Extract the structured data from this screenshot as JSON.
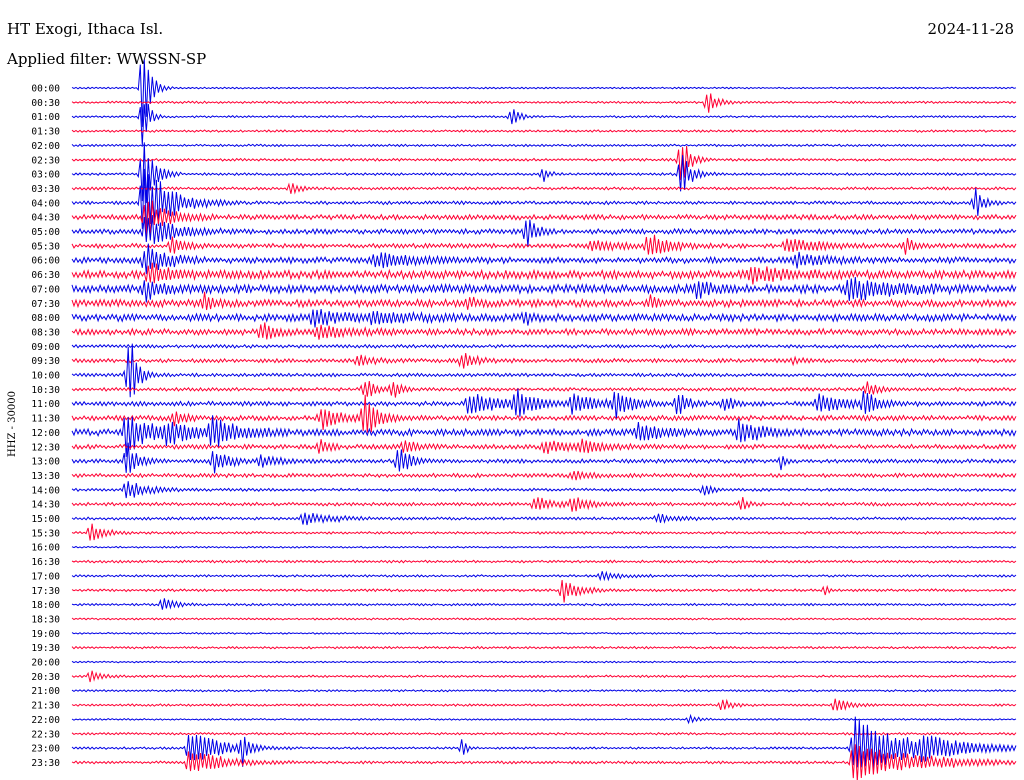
{
  "header": {
    "station": "HT Exogi, Ithaca Isl.",
    "date": "2024-11-28",
    "filter_text": "Applied filter: WWSSN-SP"
  },
  "chart_data": {
    "type": "line",
    "title": "HT Exogi, Ithaca Isl.",
    "channel_label": "HHZ - 30000",
    "colors": [
      "#0000e6",
      "#ff0033"
    ],
    "rows": [
      "00:00",
      "00:30",
      "01:00",
      "01:30",
      "02:00",
      "02:30",
      "03:00",
      "03:30",
      "04:00",
      "04:30",
      "05:00",
      "05:30",
      "06:00",
      "06:30",
      "07:00",
      "07:30",
      "08:00",
      "08:30",
      "09:00",
      "09:30",
      "10:00",
      "10:30",
      "11:00",
      "11:30",
      "12:00",
      "12:30",
      "13:00",
      "13:30",
      "14:00",
      "14:30",
      "15:00",
      "15:30",
      "16:00",
      "16:30",
      "17:00",
      "17:30",
      "18:00",
      "18:30",
      "19:00",
      "19:30",
      "20:00",
      "20:30",
      "21:00",
      "21:30",
      "22:00",
      "22:30",
      "23:00",
      "23:30"
    ],
    "noise": [
      0.6,
      0.8,
      0.7,
      0.8,
      0.8,
      0.9,
      0.9,
      1.0,
      1.2,
      1.8,
      1.8,
      1.6,
      2.2,
      3.0,
      3.0,
      2.6,
      2.6,
      2.2,
      1.2,
      1.4,
      1.2,
      1.2,
      1.6,
      1.8,
      2.4,
      1.6,
      1.4,
      1.4,
      1.0,
      1.2,
      1.0,
      0.9,
      0.6,
      0.9,
      0.8,
      0.9,
      0.8,
      0.7,
      0.6,
      0.8,
      0.6,
      0.8,
      0.7,
      0.8,
      0.6,
      0.8,
      0.8,
      1.0
    ],
    "events": [
      {
        "row": 0,
        "t": 0.075,
        "amp": 45,
        "w": 0.008
      },
      {
        "row": 1,
        "t": 0.673,
        "amp": 11,
        "w": 0.01
      },
      {
        "row": 2,
        "t": 0.075,
        "amp": 30,
        "w": 0.006
      },
      {
        "row": 2,
        "t": 0.466,
        "amp": 9,
        "w": 0.008
      },
      {
        "row": 5,
        "t": 0.645,
        "amp": 28,
        "w": 0.008
      },
      {
        "row": 6,
        "t": 0.075,
        "amp": 42,
        "w": 0.01
      },
      {
        "row": 6,
        "t": 0.499,
        "amp": 8,
        "w": 0.006
      },
      {
        "row": 6,
        "t": 0.645,
        "amp": 22,
        "w": 0.01
      },
      {
        "row": 7,
        "t": 0.232,
        "amp": 6,
        "w": 0.008
      },
      {
        "row": 8,
        "t": 0.075,
        "amp": 40,
        "w": 0.025
      },
      {
        "row": 8,
        "t": 0.957,
        "amp": 15,
        "w": 0.008
      },
      {
        "row": 9,
        "t": 0.078,
        "amp": 20,
        "w": 0.02
      },
      {
        "row": 10,
        "t": 0.078,
        "amp": 18,
        "w": 0.025
      },
      {
        "row": 10,
        "t": 0.482,
        "amp": 16,
        "w": 0.008
      },
      {
        "row": 11,
        "t": 0.105,
        "amp": 9,
        "w": 0.012
      },
      {
        "row": 11,
        "t": 0.55,
        "amp": 5,
        "w": 0.025
      },
      {
        "row": 11,
        "t": 0.61,
        "amp": 12,
        "w": 0.02
      },
      {
        "row": 11,
        "t": 0.757,
        "amp": 8,
        "w": 0.03
      },
      {
        "row": 11,
        "t": 0.883,
        "amp": 9,
        "w": 0.008
      },
      {
        "row": 12,
        "t": 0.078,
        "amp": 16,
        "w": 0.02
      },
      {
        "row": 12,
        "t": 0.32,
        "amp": 7,
        "w": 0.035
      },
      {
        "row": 12,
        "t": 0.766,
        "amp": 7,
        "w": 0.025
      },
      {
        "row": 13,
        "t": 0.082,
        "amp": 10,
        "w": 0.02
      },
      {
        "row": 13,
        "t": 0.718,
        "amp": 8,
        "w": 0.03
      },
      {
        "row": 14,
        "t": 0.078,
        "amp": 12,
        "w": 0.01
      },
      {
        "row": 14,
        "t": 0.662,
        "amp": 8,
        "w": 0.012
      },
      {
        "row": 14,
        "t": 0.822,
        "amp": 12,
        "w": 0.04
      },
      {
        "row": 15,
        "t": 0.14,
        "amp": 8,
        "w": 0.008
      },
      {
        "row": 15,
        "t": 0.42,
        "amp": 6,
        "w": 0.008
      },
      {
        "row": 15,
        "t": 0.612,
        "amp": 6,
        "w": 0.008
      },
      {
        "row": 16,
        "t": 0.254,
        "amp": 8,
        "w": 0.03
      },
      {
        "row": 16,
        "t": 0.318,
        "amp": 5,
        "w": 0.04
      },
      {
        "row": 16,
        "t": 0.48,
        "amp": 6,
        "w": 0.01
      },
      {
        "row": 17,
        "t": 0.2,
        "amp": 10,
        "w": 0.012
      },
      {
        "row": 17,
        "t": 0.26,
        "amp": 6,
        "w": 0.03
      },
      {
        "row": 19,
        "t": 0.303,
        "amp": 5,
        "w": 0.015
      },
      {
        "row": 19,
        "t": 0.413,
        "amp": 7,
        "w": 0.015
      },
      {
        "row": 19,
        "t": 0.765,
        "amp": 4,
        "w": 0.008
      },
      {
        "row": 20,
        "t": 0.06,
        "amp": 45,
        "w": 0.008
      },
      {
        "row": 21,
        "t": 0.31,
        "amp": 10,
        "w": 0.012
      },
      {
        "row": 21,
        "t": 0.34,
        "amp": 9,
        "w": 0.008
      },
      {
        "row": 21,
        "t": 0.842,
        "amp": 8,
        "w": 0.01
      },
      {
        "row": 22,
        "t": 0.42,
        "amp": 10,
        "w": 0.04
      },
      {
        "row": 22,
        "t": 0.47,
        "amp": 13,
        "w": 0.015
      },
      {
        "row": 22,
        "t": 0.53,
        "amp": 9,
        "w": 0.03
      },
      {
        "row": 22,
        "t": 0.576,
        "amp": 13,
        "w": 0.015
      },
      {
        "row": 22,
        "t": 0.641,
        "amp": 12,
        "w": 0.01
      },
      {
        "row": 22,
        "t": 0.69,
        "amp": 8,
        "w": 0.01
      },
      {
        "row": 22,
        "t": 0.79,
        "amp": 9,
        "w": 0.03
      },
      {
        "row": 22,
        "t": 0.84,
        "amp": 14,
        "w": 0.01
      },
      {
        "row": 23,
        "t": 0.108,
        "amp": 7,
        "w": 0.01
      },
      {
        "row": 23,
        "t": 0.264,
        "amp": 10,
        "w": 0.02
      },
      {
        "row": 23,
        "t": 0.309,
        "amp": 22,
        "w": 0.012
      },
      {
        "row": 24,
        "t": 0.058,
        "amp": 22,
        "w": 0.02
      },
      {
        "row": 24,
        "t": 0.1,
        "amp": 10,
        "w": 0.03
      },
      {
        "row": 24,
        "t": 0.148,
        "amp": 14,
        "w": 0.025
      },
      {
        "row": 24,
        "t": 0.6,
        "amp": 9,
        "w": 0.02
      },
      {
        "row": 24,
        "t": 0.707,
        "amp": 13,
        "w": 0.02
      },
      {
        "row": 25,
        "t": 0.262,
        "amp": 7,
        "w": 0.01
      },
      {
        "row": 25,
        "t": 0.352,
        "amp": 8,
        "w": 0.01
      },
      {
        "row": 25,
        "t": 0.5,
        "amp": 6,
        "w": 0.03
      },
      {
        "row": 25,
        "t": 0.54,
        "amp": 6,
        "w": 0.02
      },
      {
        "row": 26,
        "t": 0.058,
        "amp": 20,
        "w": 0.01
      },
      {
        "row": 26,
        "t": 0.15,
        "amp": 12,
        "w": 0.015
      },
      {
        "row": 26,
        "t": 0.2,
        "amp": 6,
        "w": 0.02
      },
      {
        "row": 26,
        "t": 0.346,
        "amp": 16,
        "w": 0.012
      },
      {
        "row": 26,
        "t": 0.752,
        "amp": 10,
        "w": 0.003
      },
      {
        "row": 27,
        "t": 0.53,
        "amp": 5,
        "w": 0.015
      },
      {
        "row": 28,
        "t": 0.058,
        "amp": 10,
        "w": 0.02
      },
      {
        "row": 28,
        "t": 0.67,
        "amp": 7,
        "w": 0.008
      },
      {
        "row": 29,
        "t": 0.49,
        "amp": 7,
        "w": 0.02
      },
      {
        "row": 29,
        "t": 0.53,
        "amp": 8,
        "w": 0.015
      },
      {
        "row": 29,
        "t": 0.71,
        "amp": 7,
        "w": 0.005
      },
      {
        "row": 30,
        "t": 0.245,
        "amp": 6,
        "w": 0.03
      },
      {
        "row": 30,
        "t": 0.62,
        "amp": 4,
        "w": 0.02
      },
      {
        "row": 31,
        "t": 0.02,
        "amp": 10,
        "w": 0.012
      },
      {
        "row": 34,
        "t": 0.56,
        "amp": 4,
        "w": 0.02
      },
      {
        "row": 35,
        "t": 0.52,
        "amp": 13,
        "w": 0.015
      },
      {
        "row": 35,
        "t": 0.798,
        "amp": 6,
        "w": 0.003
      },
      {
        "row": 36,
        "t": 0.096,
        "amp": 8,
        "w": 0.012
      },
      {
        "row": 41,
        "t": 0.02,
        "amp": 7,
        "w": 0.01
      },
      {
        "row": 43,
        "t": 0.688,
        "amp": 6,
        "w": 0.01
      },
      {
        "row": 43,
        "t": 0.808,
        "amp": 8,
        "w": 0.012
      },
      {
        "row": 44,
        "t": 0.655,
        "amp": 4,
        "w": 0.008
      },
      {
        "row": 46,
        "t": 0.124,
        "amp": 18,
        "w": 0.03
      },
      {
        "row": 46,
        "t": 0.181,
        "amp": 16,
        "w": 0.006
      },
      {
        "row": 46,
        "t": 0.414,
        "amp": 10,
        "w": 0.004
      },
      {
        "row": 46,
        "t": 0.828,
        "amp": 30,
        "w": 0.05
      },
      {
        "row": 46,
        "t": 0.9,
        "amp": 8,
        "w": 0.05
      },
      {
        "row": 47,
        "t": 0.124,
        "amp": 14,
        "w": 0.03
      },
      {
        "row": 47,
        "t": 0.828,
        "amp": 20,
        "w": 0.06
      }
    ]
  }
}
